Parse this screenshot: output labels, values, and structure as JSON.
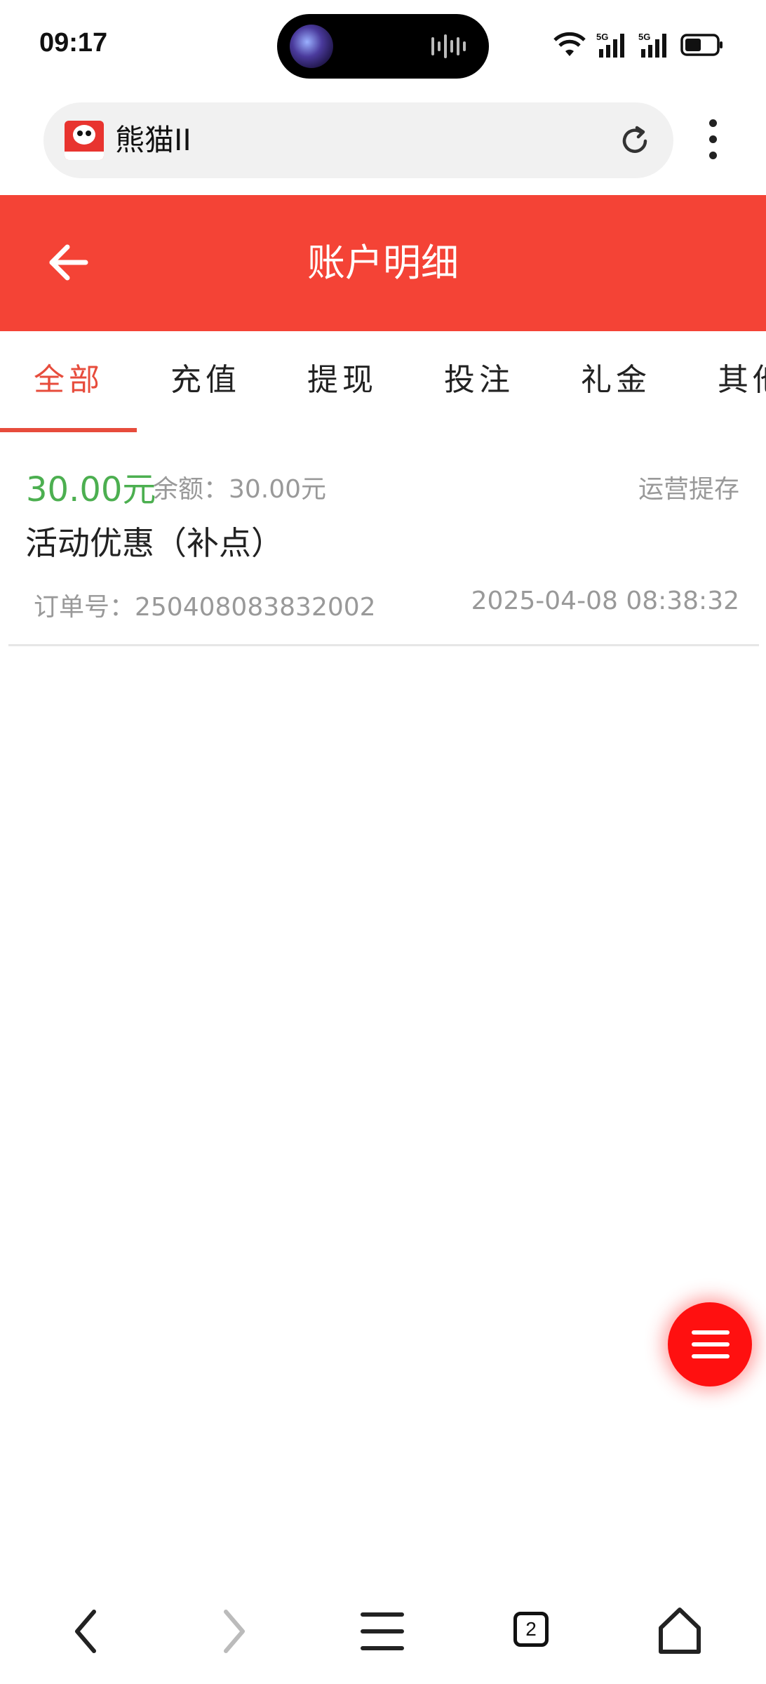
{
  "status_bar": {
    "time": "09:17"
  },
  "browser": {
    "site_name": "熊猫II"
  },
  "header": {
    "title": "账户明细"
  },
  "tabs": [
    {
      "label": "全部",
      "active": true
    },
    {
      "label": "充值",
      "active": false
    },
    {
      "label": "提现",
      "active": false
    },
    {
      "label": "投注",
      "active": false
    },
    {
      "label": "礼金",
      "active": false
    },
    {
      "label": "其他",
      "active": false
    }
  ],
  "records": [
    {
      "amount": "30.00元",
      "balance": "余额：30.00元",
      "operation": "运营提存",
      "title": "活动优惠（补点）",
      "order_no": "订单号：250408083832002",
      "time": "2025-04-08 08:38:32"
    }
  ],
  "bottom_nav": {
    "tab_count": "2"
  },
  "colors": {
    "header_red": "#f44336",
    "active_tab": "#e74c3c",
    "amount_green": "#4caf50",
    "fab_red": "#ff1010"
  }
}
